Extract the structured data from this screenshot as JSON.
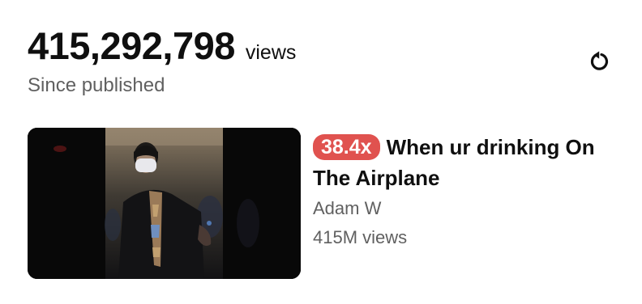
{
  "stats": {
    "views_count": "415,292,798",
    "views_unit": "views",
    "since_label": "Since published"
  },
  "refresh_icon": "refresh-icon",
  "video": {
    "multiplier_badge": "38.4x",
    "title": "When ur drinking On The Airplane",
    "channel": "Adam W",
    "views": "415M views"
  },
  "colors": {
    "badge_bg": "#e0524f",
    "primary_text": "#0f0f0f",
    "secondary_text": "#606060"
  }
}
